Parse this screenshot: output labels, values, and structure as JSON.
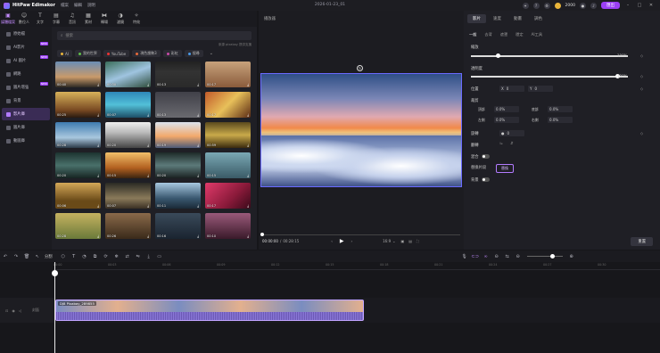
{
  "app": {
    "name": "HitPaw Edimakor",
    "menu": [
      "檔案",
      "編輯",
      "說明"
    ],
    "doc_title": "2026-01-23_01",
    "credits": "2000",
    "export_label": "匯出"
  },
  "toolbar": {
    "items": [
      {
        "label": "媒體檔案",
        "icon": "folder-icon"
      },
      {
        "label": "數位人",
        "icon": "avatar-icon"
      },
      {
        "label": "文字",
        "icon": "text-icon"
      },
      {
        "label": "字幕",
        "icon": "subtitle-icon"
      },
      {
        "label": "音訊",
        "icon": "audio-icon"
      },
      {
        "label": "素材",
        "icon": "asset-icon"
      },
      {
        "label": "轉場",
        "icon": "transition-icon"
      },
      {
        "label": "濾鏡",
        "icon": "filter-icon"
      },
      {
        "label": "特效",
        "icon": "effect-icon"
      }
    ]
  },
  "leftnav": {
    "items": [
      {
        "label": "原始檔",
        "badge": ""
      },
      {
        "label": "AI影片",
        "badge": "NEW"
      },
      {
        "label": "AI 圖片",
        "badge": "NEW"
      },
      {
        "label": "網路",
        "badge": ""
      },
      {
        "label": "圖片增強",
        "badge": "NEW"
      },
      {
        "label": "背景",
        "badge": ""
      },
      {
        "label": "影片庫",
        "badge": ""
      },
      {
        "label": "圖片庫",
        "badge": ""
      },
      {
        "label": "動圖庫",
        "badge": ""
      }
    ]
  },
  "media": {
    "search_placeholder": "搜索",
    "credit": "來源 pixabay 提供支援",
    "filters": [
      "AI",
      "我的世界",
      "YouTube",
      "現色趨勢3",
      "彩虹",
      "搜尋"
    ],
    "thumbs": [
      {
        "dur": "00:40"
      },
      {
        "dur": "00:30"
      },
      {
        "dur": "00:13"
      },
      {
        "dur": "00:17"
      },
      {
        "dur": "00:25"
      },
      {
        "dur": "00:07"
      },
      {
        "dur": "00:13"
      },
      {
        "dur": "00:17"
      },
      {
        "dur": "00:28"
      },
      {
        "dur": "00:20"
      },
      {
        "dur": "00:19"
      },
      {
        "dur": "00:59"
      },
      {
        "dur": "00:20"
      },
      {
        "dur": "00:15"
      },
      {
        "dur": "00:20"
      },
      {
        "dur": "00:15"
      },
      {
        "dur": "00:06"
      },
      {
        "dur": "00:07"
      },
      {
        "dur": "00:11"
      },
      {
        "dur": "00:17"
      },
      {
        "dur": "00:28"
      },
      {
        "dur": "00:26"
      },
      {
        "dur": "00:16"
      },
      {
        "dur": "00:10"
      }
    ]
  },
  "preview": {
    "title": "播放器",
    "time_current": "00:00:00",
    "time_total": "00:28:15",
    "ratio": "16:9"
  },
  "props": {
    "tabs": [
      "影片",
      "速度",
      "動畫",
      "調色"
    ],
    "subtabs": [
      "一般",
      "去背",
      "遮罩",
      "穩定",
      "AI工具"
    ],
    "scale_label": "縮放",
    "scale_value": "100%",
    "opacity_label": "透明度",
    "opacity_value": "100%",
    "position_label": "位置",
    "pos_x": "0",
    "pos_y": "0",
    "crop_label": "裁剪",
    "crop_top_label": "頂部",
    "crop_top": "0.0%",
    "crop_bottom_label": "底部",
    "crop_bottom": "0.0%",
    "crop_left_label": "左側",
    "crop_left": "0.0%",
    "crop_right_label": "右側",
    "crop_right": "0.0%",
    "rotate_label": "旋轉",
    "rotate_value": "0",
    "flip_label": "翻轉",
    "blend_label": "混合",
    "split_label": "替換片段",
    "split_button": "替換",
    "bg_label": "背景",
    "reset_label": "重置"
  },
  "timeline": {
    "split_label": "分割",
    "ticks": [
      "00:00",
      "00:03",
      "00:06",
      "00:09",
      "00:12",
      "00:15",
      "00:18",
      "00:21",
      "00:24",
      "00:27",
      "00:30"
    ],
    "track_label": "封面",
    "clip_name": "DJ8 Pixabay_289855"
  }
}
